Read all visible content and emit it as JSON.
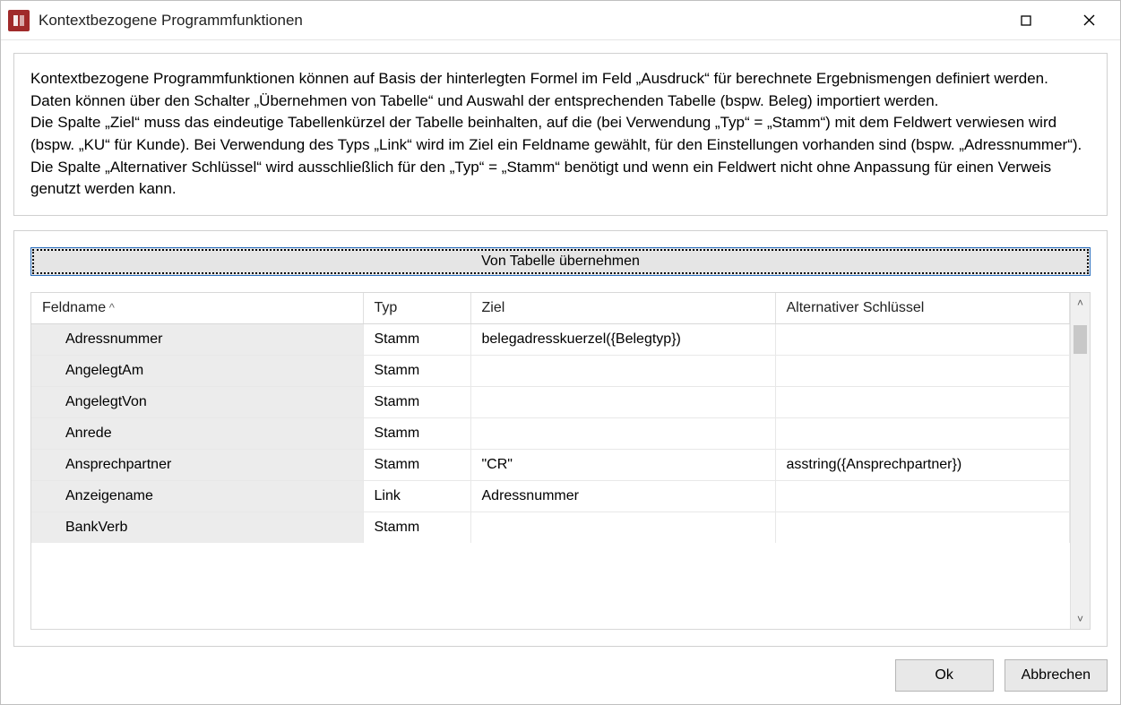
{
  "window": {
    "title": "Kontextbezogene Programmfunktionen"
  },
  "description": "Kontextbezogene Programmfunktionen können auf Basis der hinterlegten Formel im Feld „Ausdruck“ für berechnete Ergebnismengen definiert werden. Daten können über den Schalter „Übernehmen von Tabelle“ und Auswahl der entsprechenden Tabelle (bspw. Beleg) importiert werden.\nDie Spalte „Ziel“ muss das eindeutige Tabellenkürzel der Tabelle beinhalten, auf die (bei Verwendung „Typ“ = „Stamm“) mit dem Feldwert verwiesen wird (bspw. „KU“ für Kunde). Bei Verwendung des Typs „Link“ wird im Ziel ein Feldname gewählt, für den Einstellungen vorhanden sind (bspw. „Adressnummer“). Die Spalte „Alternativer Schlüssel“ wird ausschließlich für den „Typ“ = „Stamm“ benötigt und wenn ein Feldwert nicht ohne Anpassung für einen Verweis genutzt werden kann.",
  "buttons": {
    "take_from_table": "Von Tabelle übernehmen",
    "ok": "Ok",
    "cancel": "Abbrechen"
  },
  "grid": {
    "columns": {
      "fieldname": "Feldname",
      "typ": "Typ",
      "ziel": "Ziel",
      "alt": "Alternativer Schlüssel"
    },
    "sort_column": "fieldname",
    "rows": [
      {
        "fieldname": "Adressnummer",
        "typ": "Stamm",
        "ziel": "belegadresskuerzel({Belegtyp})",
        "alt": ""
      },
      {
        "fieldname": "AngelegtAm",
        "typ": "Stamm",
        "ziel": "",
        "alt": ""
      },
      {
        "fieldname": "AngelegtVon",
        "typ": "Stamm",
        "ziel": "",
        "alt": ""
      },
      {
        "fieldname": "Anrede",
        "typ": "Stamm",
        "ziel": "",
        "alt": ""
      },
      {
        "fieldname": "Ansprechpartner",
        "typ": "Stamm",
        "ziel": "\"CR\"",
        "alt": "asstring({Ansprechpartner})"
      },
      {
        "fieldname": "Anzeigename",
        "typ": "Link",
        "ziel": "Adressnummer",
        "alt": ""
      },
      {
        "fieldname": "BankVerb",
        "typ": "Stamm",
        "ziel": "",
        "alt": ""
      }
    ]
  }
}
